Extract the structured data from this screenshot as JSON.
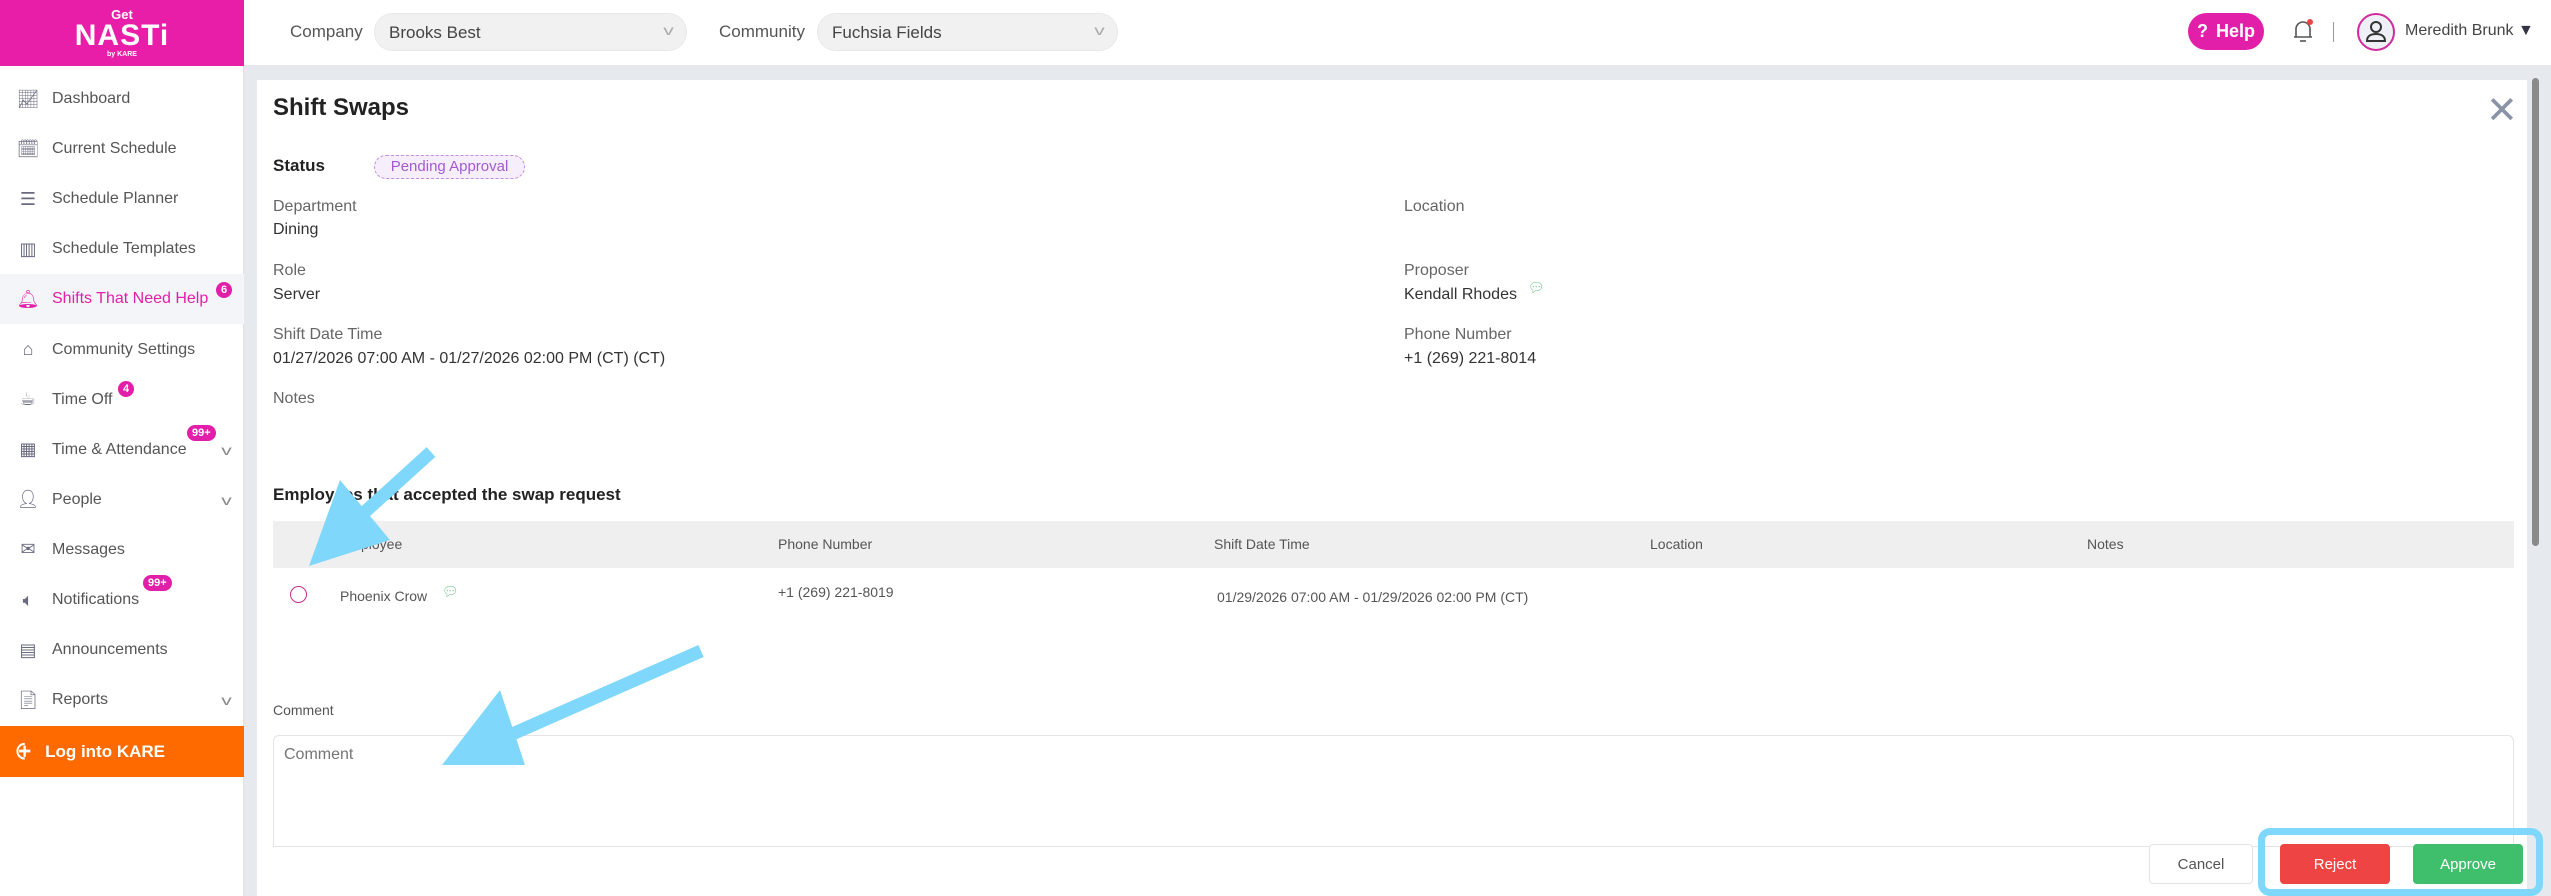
{
  "header": {
    "logo": "Get NASTi by KARE",
    "company_label": "Company",
    "company_value": "Brooks Best",
    "community_label": "Community",
    "community_value": "Fuchsia Fields",
    "help_label": "Help",
    "user_name": "Meredith Brunk"
  },
  "sidebar": {
    "items": [
      {
        "label": "Dashboard",
        "icon": "chart-line-icon"
      },
      {
        "label": "Current Schedule",
        "icon": "calendar-check-icon"
      },
      {
        "label": "Schedule Planner",
        "icon": "sliders-icon"
      },
      {
        "label": "Schedule Templates",
        "icon": "layout-icon"
      },
      {
        "label": "Shifts That Need Help",
        "icon": "bell-alert-icon",
        "badge": "6",
        "active": true
      },
      {
        "label": "Community Settings",
        "icon": "home-gear-icon"
      },
      {
        "label": "Time Off",
        "icon": "coffee-icon",
        "badge": "4"
      },
      {
        "label": "Time & Attendance",
        "icon": "timesheet-icon",
        "badge": "99+",
        "expandable": true
      },
      {
        "label": "People",
        "icon": "person-add-icon",
        "expandable": true
      },
      {
        "label": "Messages",
        "icon": "envelope-icon"
      },
      {
        "label": "Notifications",
        "icon": "speaker-icon",
        "badge": "99+"
      },
      {
        "label": "Announcements",
        "icon": "announcement-board-icon"
      },
      {
        "label": "Reports",
        "icon": "report-icon",
        "expandable": true
      }
    ],
    "kare_label": "Log into KARE"
  },
  "modal": {
    "title": "Shift Swaps",
    "status_label": "Status",
    "status_value": "Pending Approval",
    "fields": {
      "department_label": "Department",
      "department_value": "Dining",
      "location_label": "Location",
      "role_label": "Role",
      "role_value": "Server",
      "proposer_label": "Proposer",
      "proposer_value": "Kendall Rhodes",
      "shift_label": "Shift Date Time",
      "shift_value": "01/27/2026 07:00 AM - 01/27/2026 02:00 PM (CT) (CT)",
      "phone_label": "Phone Number",
      "phone_value": "+1 (269) 221-8014",
      "notes_label": "Notes"
    },
    "section_title": "Employees that accepted the swap request",
    "table": {
      "columns": [
        "Employee",
        "Phone Number",
        "Shift Date Time",
        "Location",
        "Notes"
      ],
      "rows": [
        {
          "employee": "Phoenix Crow",
          "phone": "+1 (269) 221-8019",
          "shift": "01/29/2026 07:00 AM - 01/29/2026 02:00 PM (CT)",
          "location": "",
          "notes": ""
        }
      ]
    },
    "comment_label": "Comment",
    "comment_placeholder": "Comment",
    "comment_value": "",
    "buttons": {
      "cancel": "Cancel",
      "reject": "Reject",
      "approve": "Approve"
    }
  },
  "colors": {
    "brand": "#e91ea8",
    "kare": "#ff6a00",
    "reject": "#ef4444",
    "approve": "#3fbe6c",
    "annotation": "#7fd8fb"
  }
}
